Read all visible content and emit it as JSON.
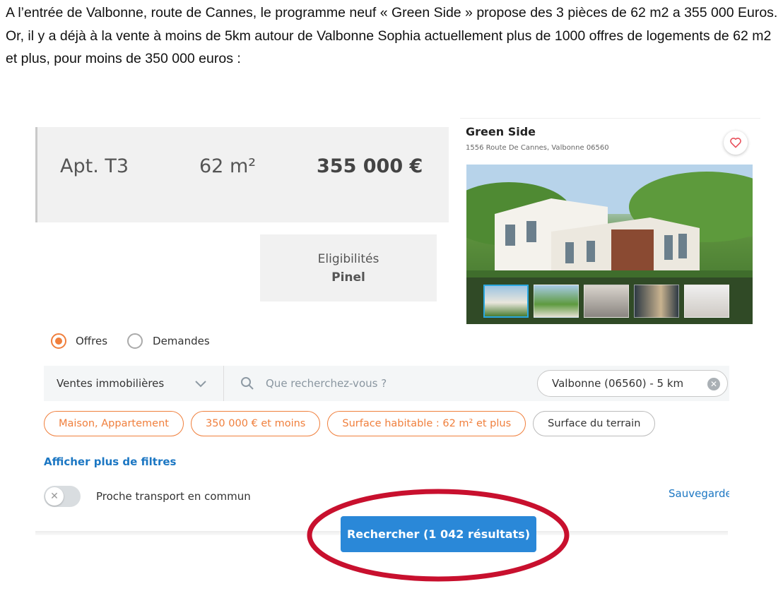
{
  "intro_text": "A l’entrée de Valbonne, route de Cannes, le programme neuf « Green Side » propose des 3 pièces de 62 m2 a 355 000 Euros. Or, il y a déjà à la vente à moins de 5km autour de Valbonne Sophia actuellement plus de 1000 offres de logements de 62 m2 et plus, pour moins de 350 000 euros :",
  "listing": {
    "type": "Apt. T3",
    "area": "62 m²",
    "price": "355 000 €",
    "eligibility_label": "Eligibilités",
    "eligibility_value": "Pinel"
  },
  "card": {
    "title": "Green Side",
    "address": "1556 Route De Cannes, Valbonne 06560",
    "favorite_icon": "heart-icon",
    "thumbnail_count": 5,
    "active_thumbnail": 1
  },
  "search": {
    "radio_offers": "Offres",
    "radio_requests": "Demandes",
    "selected_radio": "Offres",
    "category": "Ventes immobilières",
    "query_placeholder": "Que recherchez-vous ?",
    "location": "Valbonne (06560) - 5 km",
    "chips": {
      "type": "Maison, Appartement",
      "price": "350 000 € et moins",
      "surface": "Surface habitable : 62 m² et plus",
      "land": "Surface du terrain"
    },
    "more_filters": "Afficher plus de filtres",
    "transport_toggle": "Proche transport en commun",
    "transport_enabled": false,
    "save_label": "Sauvegarder",
    "submit_label": "Rechercher (1 042 résultats)"
  },
  "colors": {
    "accent_orange": "#f07f3c",
    "link_blue": "#1c77c3",
    "button_blue": "#2a88d8",
    "annotation_red": "#c8102e"
  }
}
